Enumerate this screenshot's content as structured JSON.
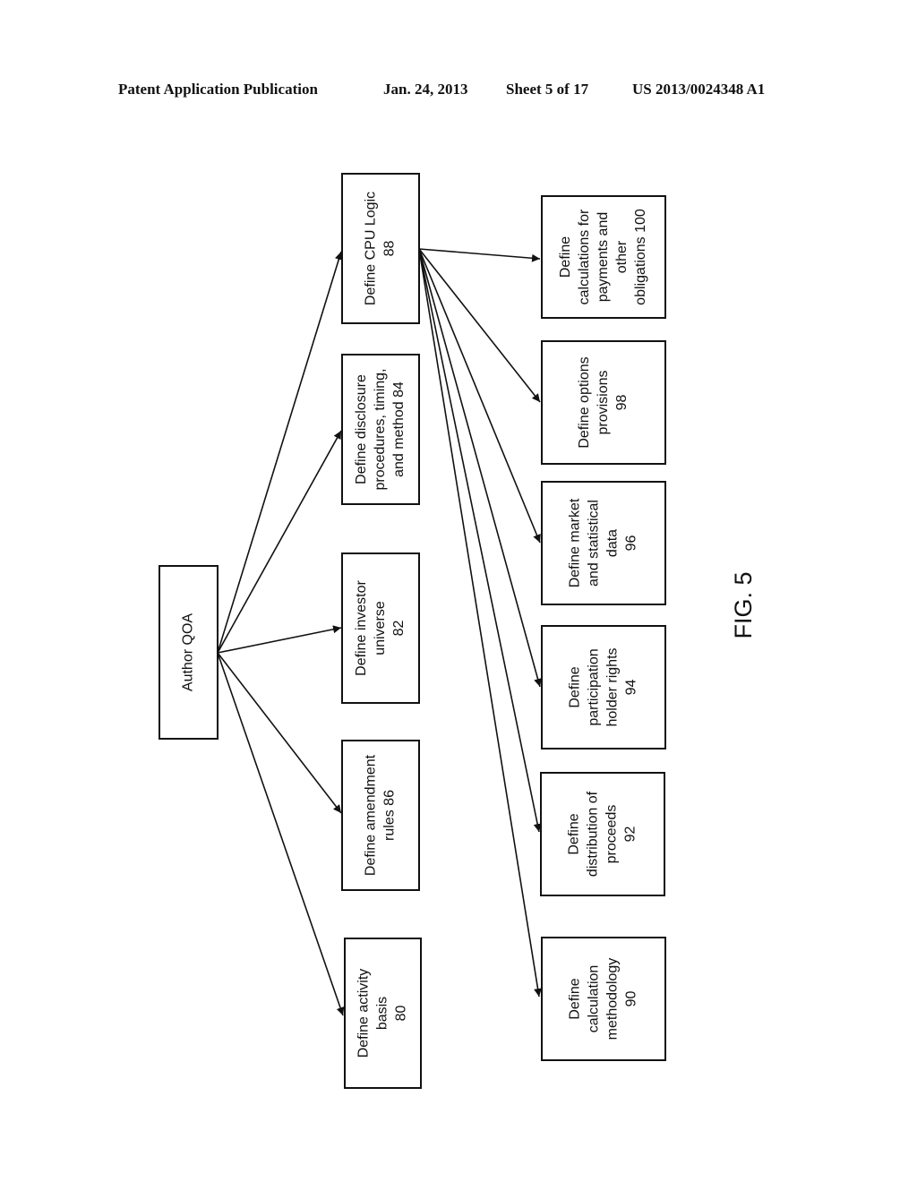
{
  "header": {
    "publication": "Patent Application Publication",
    "date": "Jan. 24, 2013",
    "sheet": "Sheet 5 of 17",
    "number": "US 2013/0024348 A1"
  },
  "figure_label": "FIG. 5",
  "diagram": {
    "root": {
      "id": "author",
      "lines": [
        "Author QOA"
      ]
    },
    "level1": [
      {
        "id": "n80",
        "lines": [
          "Define activity",
          "basis",
          "80"
        ]
      },
      {
        "id": "n86",
        "lines": [
          "Define amendment",
          "rules  86"
        ]
      },
      {
        "id": "n82",
        "lines": [
          "Define investor",
          "universe",
          "82"
        ]
      },
      {
        "id": "n84",
        "lines": [
          "Define disclosure",
          "procedures, timing,",
          "and method  84"
        ]
      },
      {
        "id": "n88",
        "lines": [
          "Define CPU Logic",
          "88"
        ]
      }
    ],
    "level2": [
      {
        "id": "n90",
        "lines": [
          "Define",
          "calculation",
          "methodology",
          "90"
        ]
      },
      {
        "id": "n92",
        "lines": [
          "Define",
          "distribution of",
          "proceeds",
          "92"
        ]
      },
      {
        "id": "n94",
        "lines": [
          "Define",
          "participation",
          "holder rights",
          "94"
        ]
      },
      {
        "id": "n96",
        "lines": [
          "Define market",
          "and statistical",
          "data",
          "96"
        ]
      },
      {
        "id": "n98",
        "lines": [
          "Define options",
          "provisions",
          "98"
        ]
      },
      {
        "id": "n100",
        "lines": [
          "Define",
          "calculations for",
          "payments and",
          "other",
          "obligations 100"
        ]
      }
    ],
    "edges": [
      [
        "author",
        "n80"
      ],
      [
        "author",
        "n86"
      ],
      [
        "author",
        "n82"
      ],
      [
        "author",
        "n84"
      ],
      [
        "author",
        "n88"
      ],
      [
        "n88",
        "n90"
      ],
      [
        "n88",
        "n92"
      ],
      [
        "n88",
        "n94"
      ],
      [
        "n88",
        "n96"
      ],
      [
        "n88",
        "n98"
      ],
      [
        "n88",
        "n100"
      ]
    ]
  }
}
